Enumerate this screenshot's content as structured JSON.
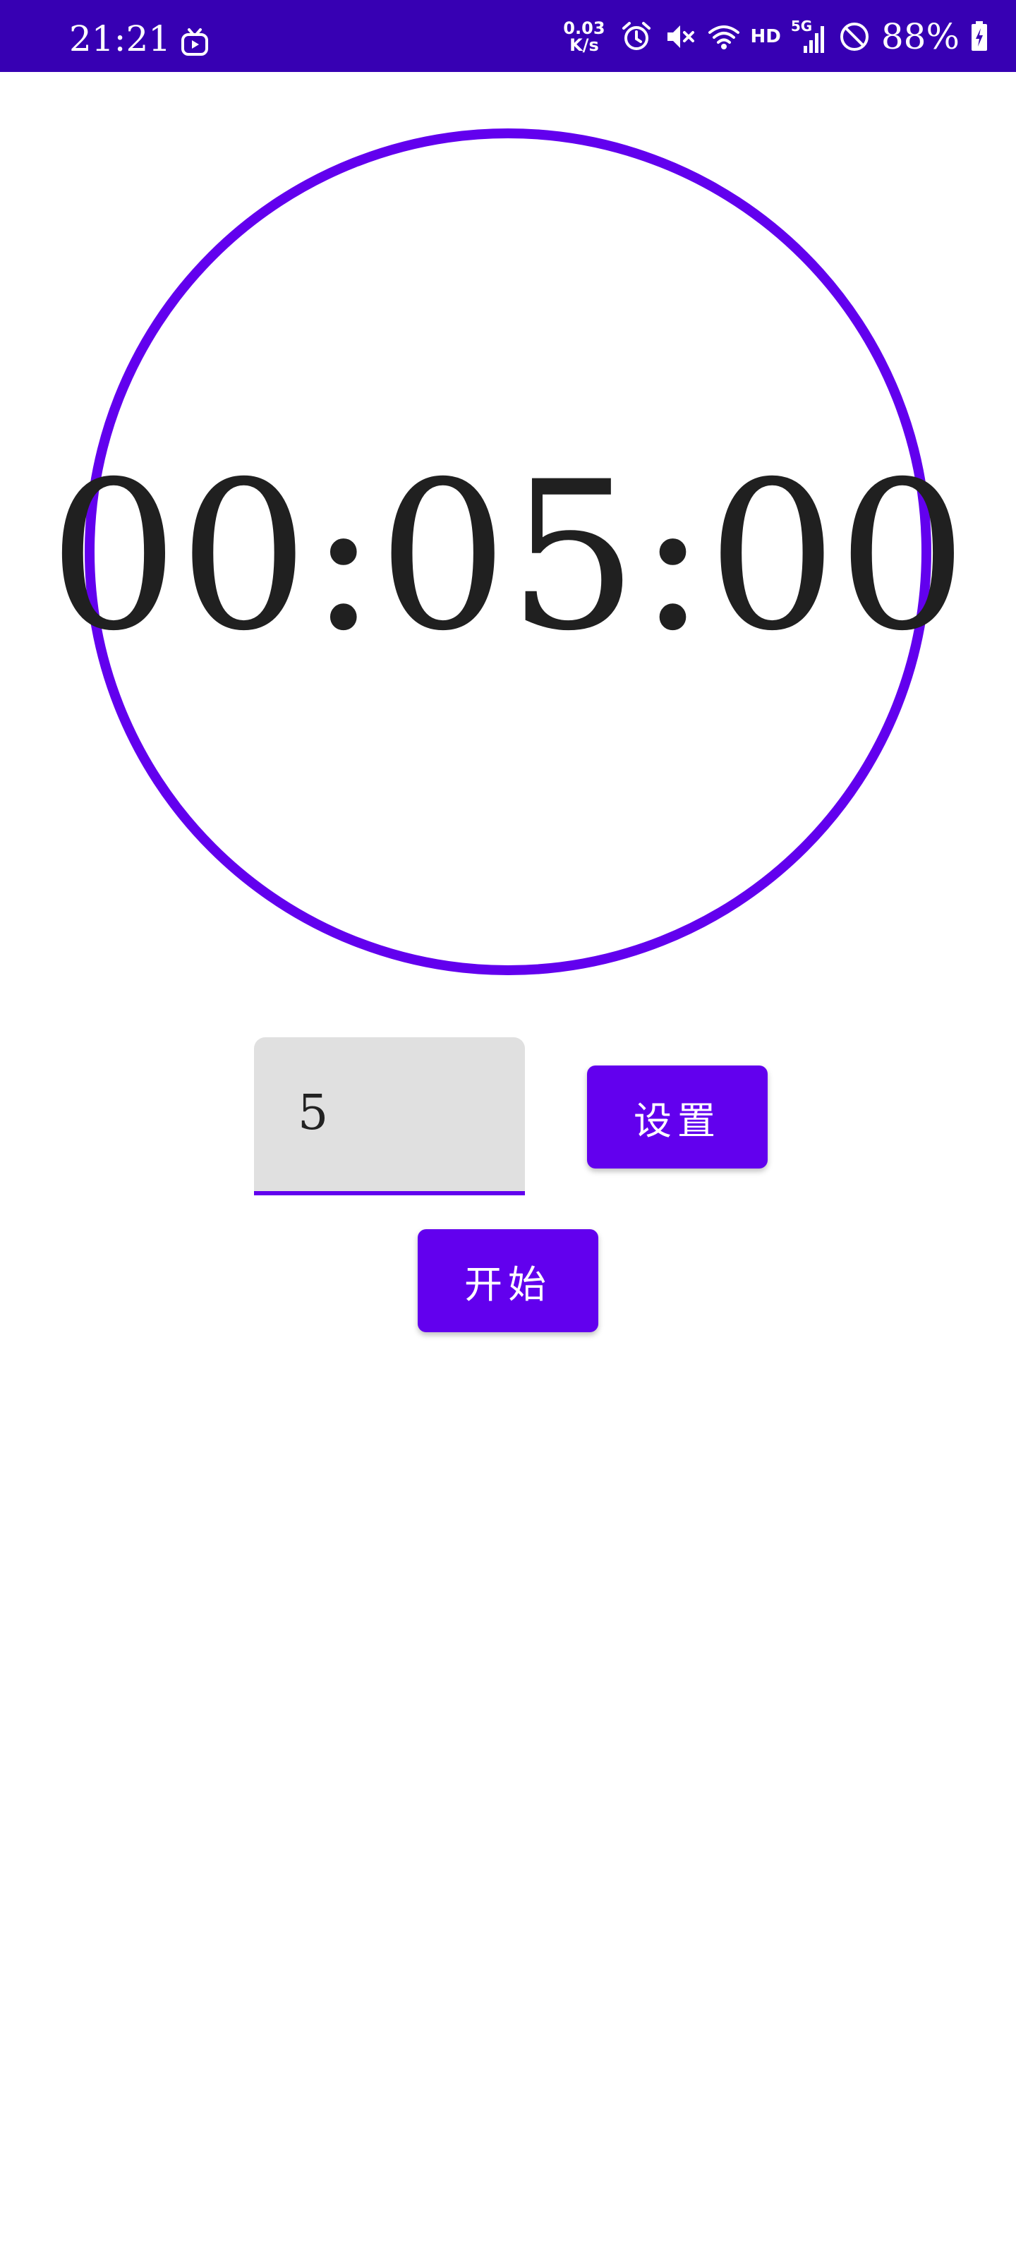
{
  "status_bar": {
    "time": "21:21",
    "speed_value": "0.03",
    "speed_unit": "K/s",
    "hd_label": "HD",
    "network_label": "5G",
    "battery": "88%",
    "background_color": "#3700b3",
    "icons": [
      "tv-icon",
      "alarm-icon",
      "mute-icon",
      "wifi-icon",
      "signal-icon",
      "do-not-disturb-icon",
      "battery-charging-icon"
    ]
  },
  "timer": {
    "display": "00:05:00",
    "ring_color": "#6200ee"
  },
  "minutes_input": {
    "value": "5"
  },
  "buttons": {
    "set_label": "设置",
    "start_label": "开始",
    "color": "#6200ee"
  }
}
